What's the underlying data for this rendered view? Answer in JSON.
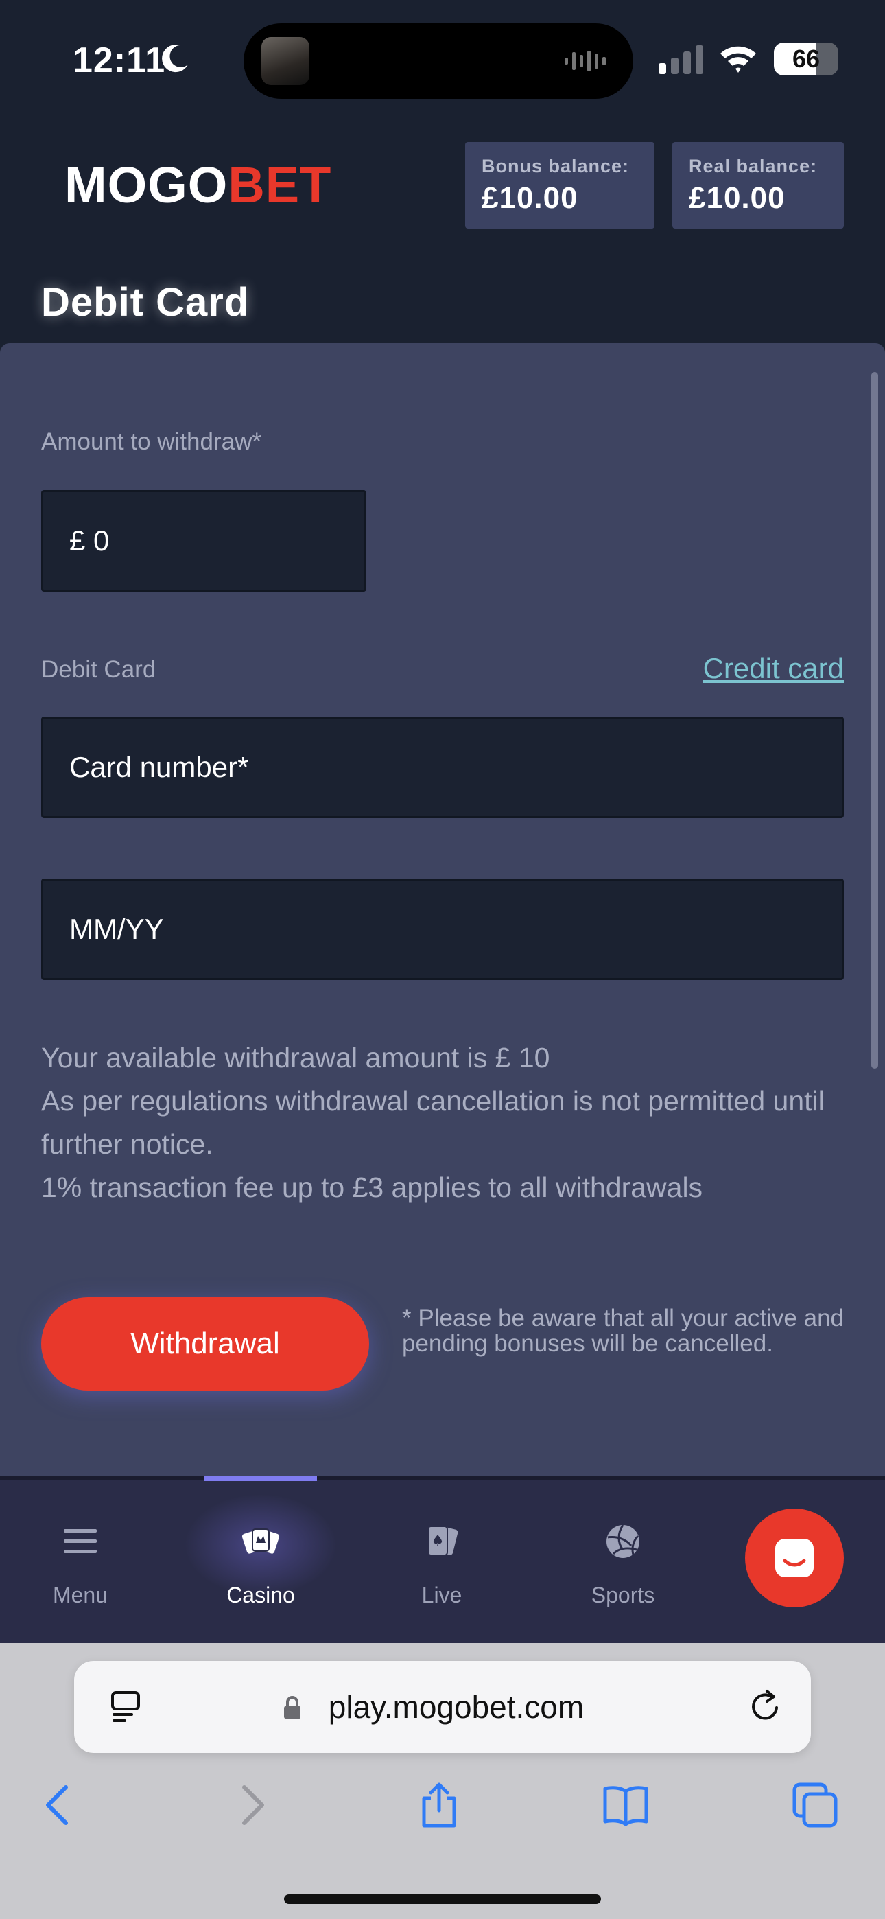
{
  "status_bar": {
    "time": "12:11",
    "battery": "66",
    "battery_level": 0.66,
    "icons": [
      "moon-icon",
      "waveform-icon",
      "signal-icon",
      "wifi-icon",
      "battery-icon"
    ]
  },
  "header": {
    "logo_left": "MOGO",
    "logo_right": "BET",
    "bonus_label": "Bonus balance:",
    "bonus_value": "£10.00",
    "real_label": "Real balance:",
    "real_value": "£10.00",
    "title": "Debit Card"
  },
  "form": {
    "amount_label": "Amount to withdraw*",
    "amount_value": "£ 0",
    "card_type_label": "Debit Card",
    "credit_card_link": "Credit card",
    "card_number_placeholder": "Card number*",
    "expiry_placeholder": "MM/YY",
    "info_line1": "Your available withdrawal amount is £ 10",
    "info_line2": "As per regulations withdrawal cancellation is not permitted until further notice.",
    "info_line3": "1% transaction fee up to £3 applies to all withdrawals",
    "withdraw_button": "Withdrawal",
    "note": "* Please be aware that all your active and pending bonuses will be cancelled."
  },
  "bottom_nav": {
    "items": [
      {
        "label": "Menu",
        "icon": "menu-icon"
      },
      {
        "label": "Casino",
        "icon": "casino-icon",
        "active": true
      },
      {
        "label": "Live",
        "icon": "live-cards-icon"
      },
      {
        "label": "Sports",
        "icon": "sports-ball-icon"
      }
    ],
    "chat_icon": "chat-icon"
  },
  "browser": {
    "url": "play.mogobet.com",
    "toolbar_icons": [
      "back-icon",
      "forward-icon",
      "share-icon",
      "bookmarks-icon",
      "tabs-icon"
    ]
  },
  "colors": {
    "accent_red": "#e8382b",
    "panel": "#3e4461",
    "background": "#1a2130",
    "link": "#7cc4d0",
    "nav_active": "#7f7cf0"
  }
}
